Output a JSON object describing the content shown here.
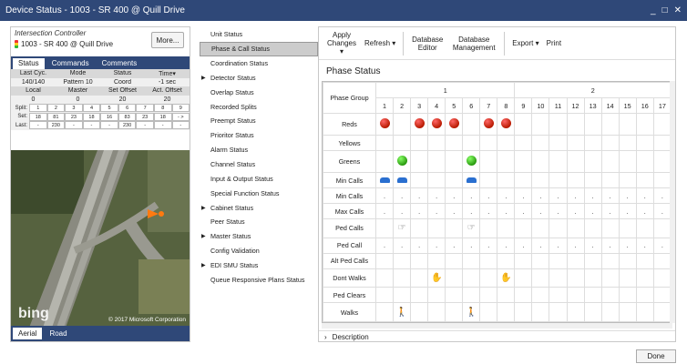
{
  "window": {
    "title": "Device Status - 1003 - SR 400 @ Quill Drive",
    "min": "_",
    "max": "□",
    "close": "✕"
  },
  "controller": {
    "label": "Intersection Controller",
    "name": "1003 - SR 400 @ Quill Drive",
    "more": "More..."
  },
  "tabs": [
    "Status",
    "Commands",
    "Comments"
  ],
  "status": {
    "row1h": [
      "Last Cyc.",
      "Mode",
      "Status",
      "Time▾"
    ],
    "row1": [
      "140/140",
      "Pattern 10",
      "Coord",
      "-1 sec"
    ],
    "row2h": [
      "Local",
      "Master",
      "Set Offset",
      "Act. Offset"
    ],
    "row2": [
      "0",
      "0",
      "20",
      "20"
    ],
    "grid": [
      {
        "label": "Split:",
        "cells": [
          "1",
          "2",
          "3",
          "4",
          "5",
          "6",
          "7",
          "8",
          "9"
        ]
      },
      {
        "label": "Set:",
        "cells": [
          "18",
          "81",
          "23",
          "18",
          "16",
          "83",
          "23",
          "18",
          "- >"
        ]
      },
      {
        "label": "Last:",
        "cells": [
          "-",
          "230",
          "-",
          "-",
          "-",
          "230",
          "-",
          "-",
          "-"
        ]
      }
    ]
  },
  "map": {
    "brand": "bing",
    "copyright": "© 2017 Microsoft Corporation",
    "tabs": [
      "Aerial",
      "Road"
    ]
  },
  "menu": [
    {
      "label": "Unit Status",
      "arrow": ""
    },
    {
      "label": "Phase & Call Status",
      "arrow": "",
      "selected": true
    },
    {
      "label": "Coordination Status",
      "arrow": ""
    },
    {
      "label": "Detector Status",
      "arrow": "▶"
    },
    {
      "label": "Overlap Status",
      "arrow": ""
    },
    {
      "label": "Recorded Splits",
      "arrow": ""
    },
    {
      "label": "Preempt Status",
      "arrow": ""
    },
    {
      "label": "Prioritor Status",
      "arrow": ""
    },
    {
      "label": "Alarm Status",
      "arrow": ""
    },
    {
      "label": "Channel Status",
      "arrow": ""
    },
    {
      "label": "Input & Output Status",
      "arrow": ""
    },
    {
      "label": "Special Function Status",
      "arrow": ""
    },
    {
      "label": "Cabinet Status",
      "arrow": "▶"
    },
    {
      "label": "Peer Status",
      "arrow": ""
    },
    {
      "label": "Master Status",
      "arrow": "▶"
    },
    {
      "label": "Config Validation",
      "arrow": ""
    },
    {
      "label": "EDI SMU Status",
      "arrow": "▶"
    },
    {
      "label": "Queue Responsive Plans Status",
      "arrow": ""
    }
  ],
  "toolbar": {
    "apply": "Apply Changes ▾",
    "refresh": "Refresh ▾",
    "db_editor": "Database Editor",
    "db_mgmt": "Database Management",
    "export": "Export ▾",
    "print": "Print"
  },
  "phase": {
    "title": "Phase Status",
    "header": "Phase Group",
    "groups": [
      "1",
      "2"
    ],
    "phases": [
      "1",
      "2",
      "3",
      "4",
      "5",
      "6",
      "7",
      "8",
      "9",
      "10",
      "11",
      "12",
      "13",
      "14",
      "15",
      "16",
      "17"
    ],
    "rows": [
      {
        "label": "Reds",
        "cells": [
          "red",
          "",
          "red",
          "red",
          "red",
          "",
          "red",
          "red",
          "",
          "",
          "",
          "",
          "",
          "",
          "",
          "",
          ""
        ]
      },
      {
        "label": "Yellows",
        "cells": [
          "",
          "",
          "",
          "",
          "",
          "",
          "",
          "",
          "",
          "",
          "",
          "",
          "",
          "",
          "",
          "",
          ""
        ]
      },
      {
        "label": "Greens",
        "cells": [
          "",
          "green",
          "",
          "",
          "",
          "green",
          "",
          "",
          "",
          "",
          "",
          "",
          "",
          "",
          "",
          "",
          ""
        ]
      },
      {
        "label": "Min Calls",
        "cells": [
          "car",
          "car",
          "",
          "",
          "",
          "car",
          "",
          "",
          "",
          "",
          "",
          "",
          "",
          "",
          "",
          "",
          ""
        ]
      },
      {
        "label": "Min Calls",
        "cells": [
          ".",
          ".",
          ".",
          ".",
          ".",
          ".",
          ".",
          ".",
          ".",
          ".",
          ".",
          ".",
          ".",
          ".",
          ".",
          ".",
          "."
        ]
      },
      {
        "label": "Max Calls",
        "cells": [
          ".",
          ".",
          ".",
          ".",
          ".",
          ".",
          ".",
          ".",
          ".",
          ".",
          ".",
          ".",
          ".",
          ".",
          ".",
          ".",
          "."
        ]
      },
      {
        "label": "Ped Calls",
        "cells": [
          "",
          "ptr",
          "",
          "",
          "",
          "ptr",
          "",
          "",
          "",
          "",
          "",
          "",
          "",
          "",
          "",
          "",
          ""
        ]
      },
      {
        "label": "Ped Call",
        "cells": [
          ".",
          ".",
          ".",
          ".",
          ".",
          ".",
          ".",
          ".",
          ".",
          ".",
          ".",
          ".",
          ".",
          ".",
          ".",
          ".",
          "."
        ]
      },
      {
        "label": "Alt Ped Calls",
        "cells": [
          "",
          "",
          "",
          "",
          "",
          "",
          "",
          "",
          "",
          "",
          "",
          "",
          "",
          "",
          "",
          "",
          ""
        ]
      },
      {
        "label": "Dont Walks",
        "cells": [
          "",
          "",
          "",
          "hand",
          "",
          "",
          "",
          "hand",
          "",
          "",
          "",
          "",
          "",
          "",
          "",
          "",
          ""
        ]
      },
      {
        "label": "Ped Clears",
        "cells": [
          "",
          "",
          "",
          "",
          "",
          "",
          "",
          "",
          "",
          "",
          "",
          "",
          "",
          "",
          "",
          "",
          ""
        ]
      },
      {
        "label": "Walks",
        "cells": [
          "",
          "walk",
          "",
          "",
          "",
          "walk",
          "",
          "",
          "",
          "",
          "",
          "",
          "",
          "",
          "",
          "",
          ""
        ]
      }
    ]
  },
  "description": {
    "arrow": "›",
    "label": "Description"
  },
  "done": "Done"
}
